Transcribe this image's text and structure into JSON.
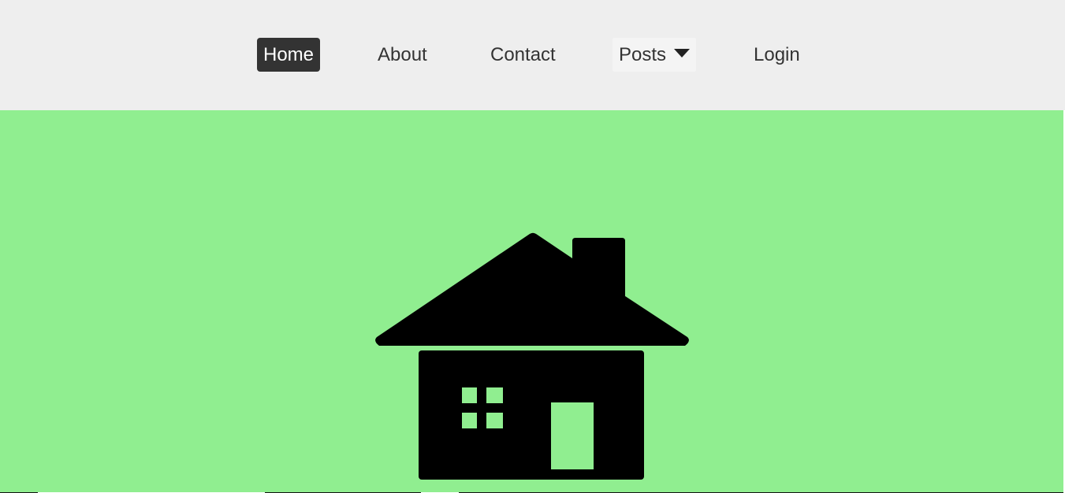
{
  "nav": {
    "items": [
      {
        "label": "Home",
        "active": true
      },
      {
        "label": "About",
        "active": false
      },
      {
        "label": "Contact",
        "active": false
      },
      {
        "label": "Posts",
        "active": false,
        "has_dropdown": true
      },
      {
        "label": "Login",
        "active": false
      }
    ]
  },
  "hero": {
    "background_color": "#90ee90",
    "icon": "house-icon"
  },
  "colors": {
    "navbar_bg": "#eeeeee",
    "active_bg": "#333333",
    "active_text": "#ffffff",
    "text": "#333333",
    "icon": "#000000"
  }
}
